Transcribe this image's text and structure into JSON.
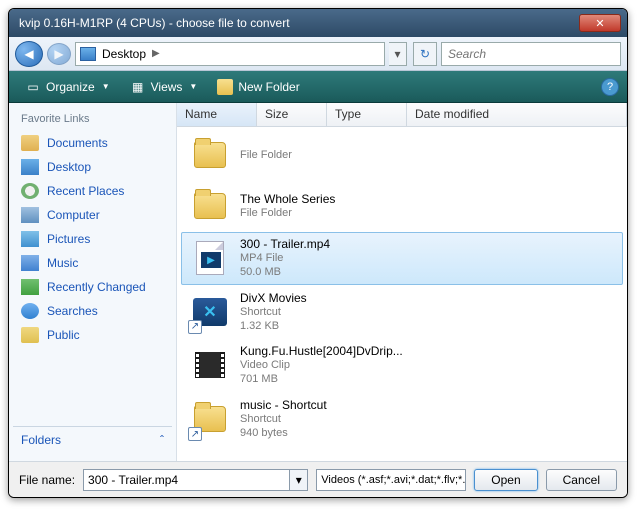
{
  "window": {
    "title": "kvip 0.16H-M1RP (4 CPUs) - choose file to convert"
  },
  "nav": {
    "location": "Desktop",
    "search_placeholder": "Search"
  },
  "toolbar": {
    "organize": "Organize",
    "views": "Views",
    "new_folder": "New Folder"
  },
  "sidebar": {
    "heading": "Favorite Links",
    "items": [
      {
        "label": "Documents",
        "icon": "sb-ic-doc"
      },
      {
        "label": "Desktop",
        "icon": "sb-ic-desk"
      },
      {
        "label": "Recent Places",
        "icon": "sb-ic-clock"
      },
      {
        "label": "Computer",
        "icon": "sb-ic-comp"
      },
      {
        "label": "Pictures",
        "icon": "sb-ic-pic"
      },
      {
        "label": "Music",
        "icon": "sb-ic-music"
      },
      {
        "label": "Recently Changed",
        "icon": "sb-ic-recent"
      },
      {
        "label": "Searches",
        "icon": "sb-ic-search"
      },
      {
        "label": "Public",
        "icon": "sb-ic-public"
      }
    ],
    "folders": "Folders"
  },
  "columns": [
    "Name",
    "Size",
    "Type",
    "Date modified"
  ],
  "files": [
    {
      "name": "",
      "meta1": "File Folder",
      "meta2": "",
      "kind": "folder",
      "selected": false,
      "shortcut": false
    },
    {
      "name": "The Whole Series",
      "meta1": "File Folder",
      "meta2": "",
      "kind": "folder",
      "selected": false,
      "shortcut": false
    },
    {
      "name": "300 - Trailer.mp4",
      "meta1": "MP4 File",
      "meta2": "50.0 MB",
      "kind": "mp4",
      "selected": true,
      "shortcut": false
    },
    {
      "name": "DivX Movies",
      "meta1": "Shortcut",
      "meta2": "1.32 KB",
      "kind": "divx",
      "selected": false,
      "shortcut": true
    },
    {
      "name": "Kung.Fu.Hustle[2004]DvDrip...",
      "meta1": "Video Clip",
      "meta2": "701 MB",
      "kind": "film",
      "selected": false,
      "shortcut": false
    },
    {
      "name": "music - Shortcut",
      "meta1": "Shortcut",
      "meta2": "940 bytes",
      "kind": "folder",
      "selected": false,
      "shortcut": true
    }
  ],
  "footer": {
    "filename_label": "File name:",
    "filename_value": "300 - Trailer.mp4",
    "filter": "Videos (*.asf;*.avi;*.dat;*.flv;*.",
    "open": "Open",
    "cancel": "Cancel"
  }
}
